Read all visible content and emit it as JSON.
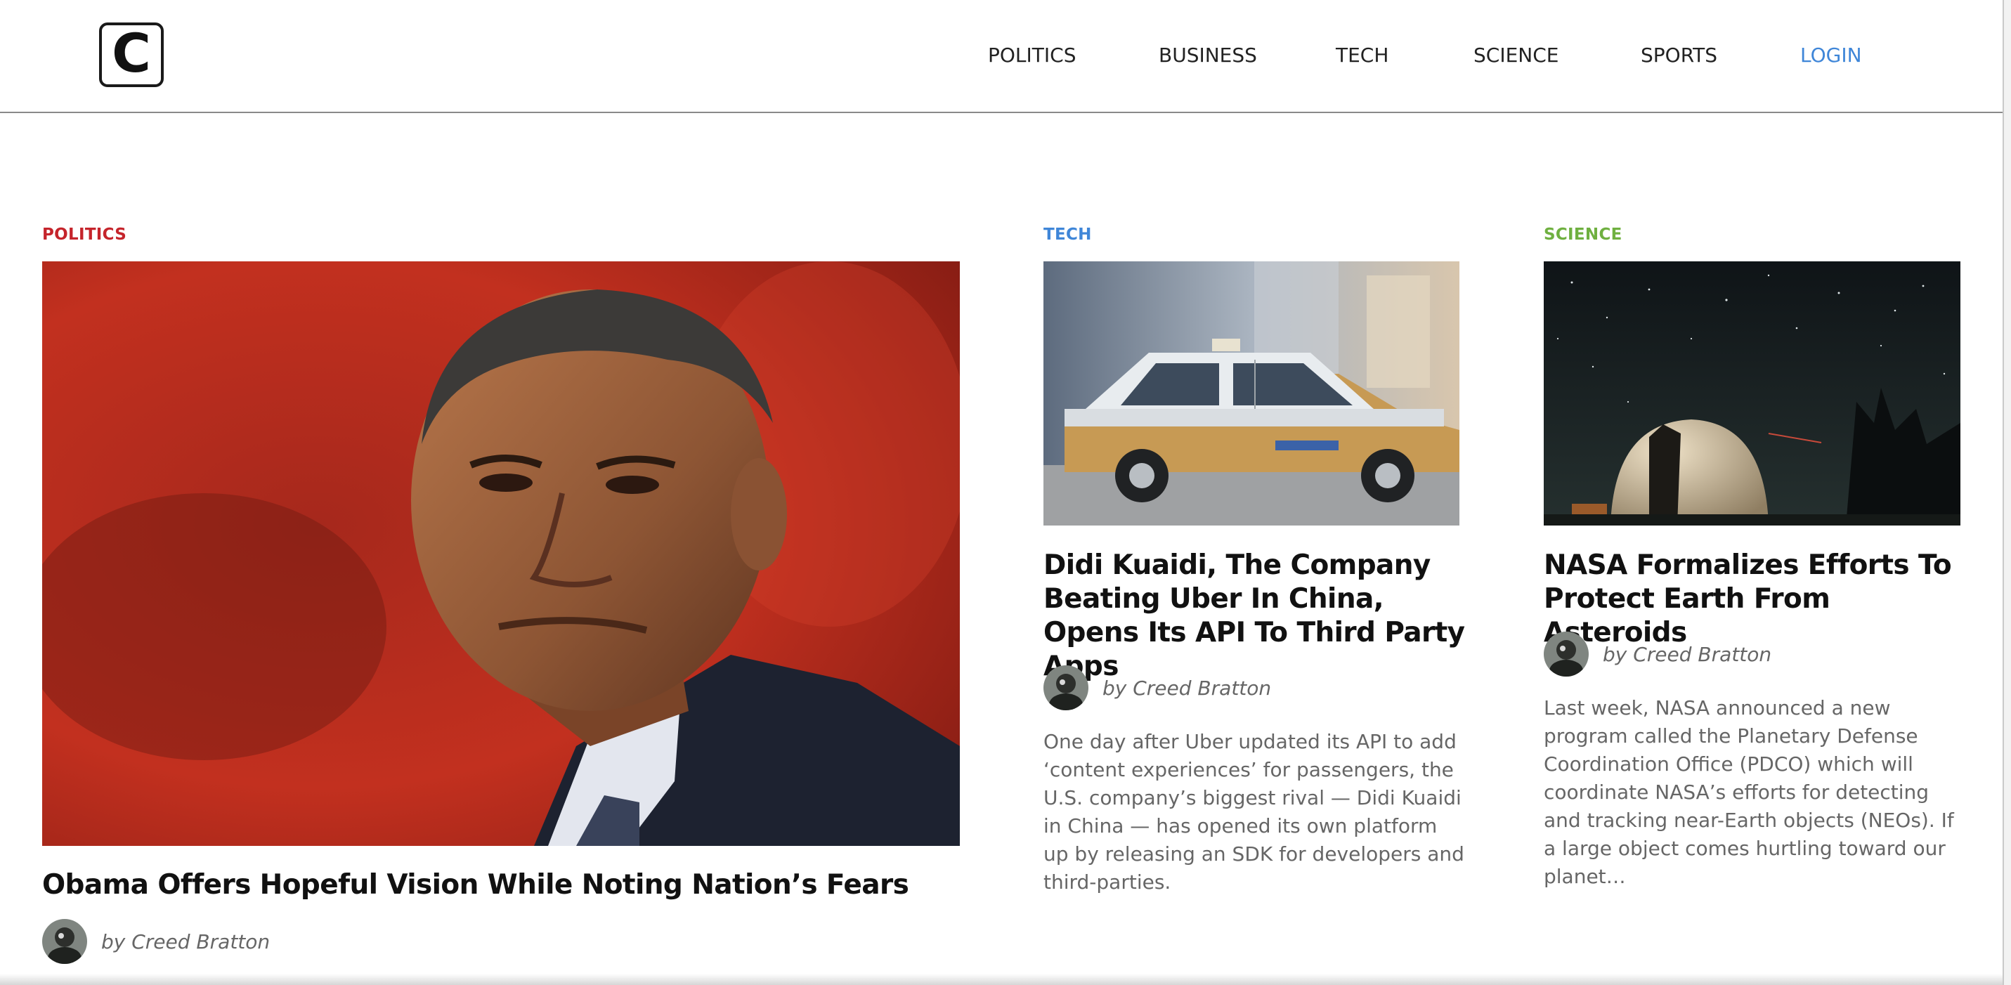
{
  "brand": {
    "logo_letter": "C"
  },
  "nav": {
    "items": [
      {
        "label": "POLITICS"
      },
      {
        "label": "BUSINESS"
      },
      {
        "label": "TECH"
      },
      {
        "label": "SCIENCE"
      },
      {
        "label": "SPORTS"
      }
    ],
    "login_label": "LOGIN"
  },
  "colors": {
    "politics": "#c5242b",
    "tech": "#3f86d8",
    "science": "#6fb040",
    "login": "#3f86d8"
  },
  "articles": [
    {
      "category": "POLITICS",
      "title": "Obama Offers Hopeful Vision While Noting Nation’s Fears",
      "author": "by Creed Bratton"
    },
    {
      "category": "TECH",
      "title": "Didi Kuaidi, The Company Beating Uber In China, Opens Its API To Third Party Apps",
      "author": "by Creed Bratton",
      "excerpt": "One day after Uber updated its API to add ‘content experiences’ for passengers, the U.S. company’s biggest rival — Didi Kuaidi in China — has opened its own platform up by releasing an SDK for developers and third-parties."
    },
    {
      "category": "SCIENCE",
      "title": "NASA Formalizes Efforts To Protect Earth From Asteroids",
      "author": "by Creed Bratton",
      "excerpt": "Last week, NASA announced a new program called the Planetary Defense Coordination Office (PDCO) which will coordinate NASA’s efforts for detecting and tracking near-Earth objects (NEOs). If a large object comes hurtling toward our planet…"
    }
  ]
}
